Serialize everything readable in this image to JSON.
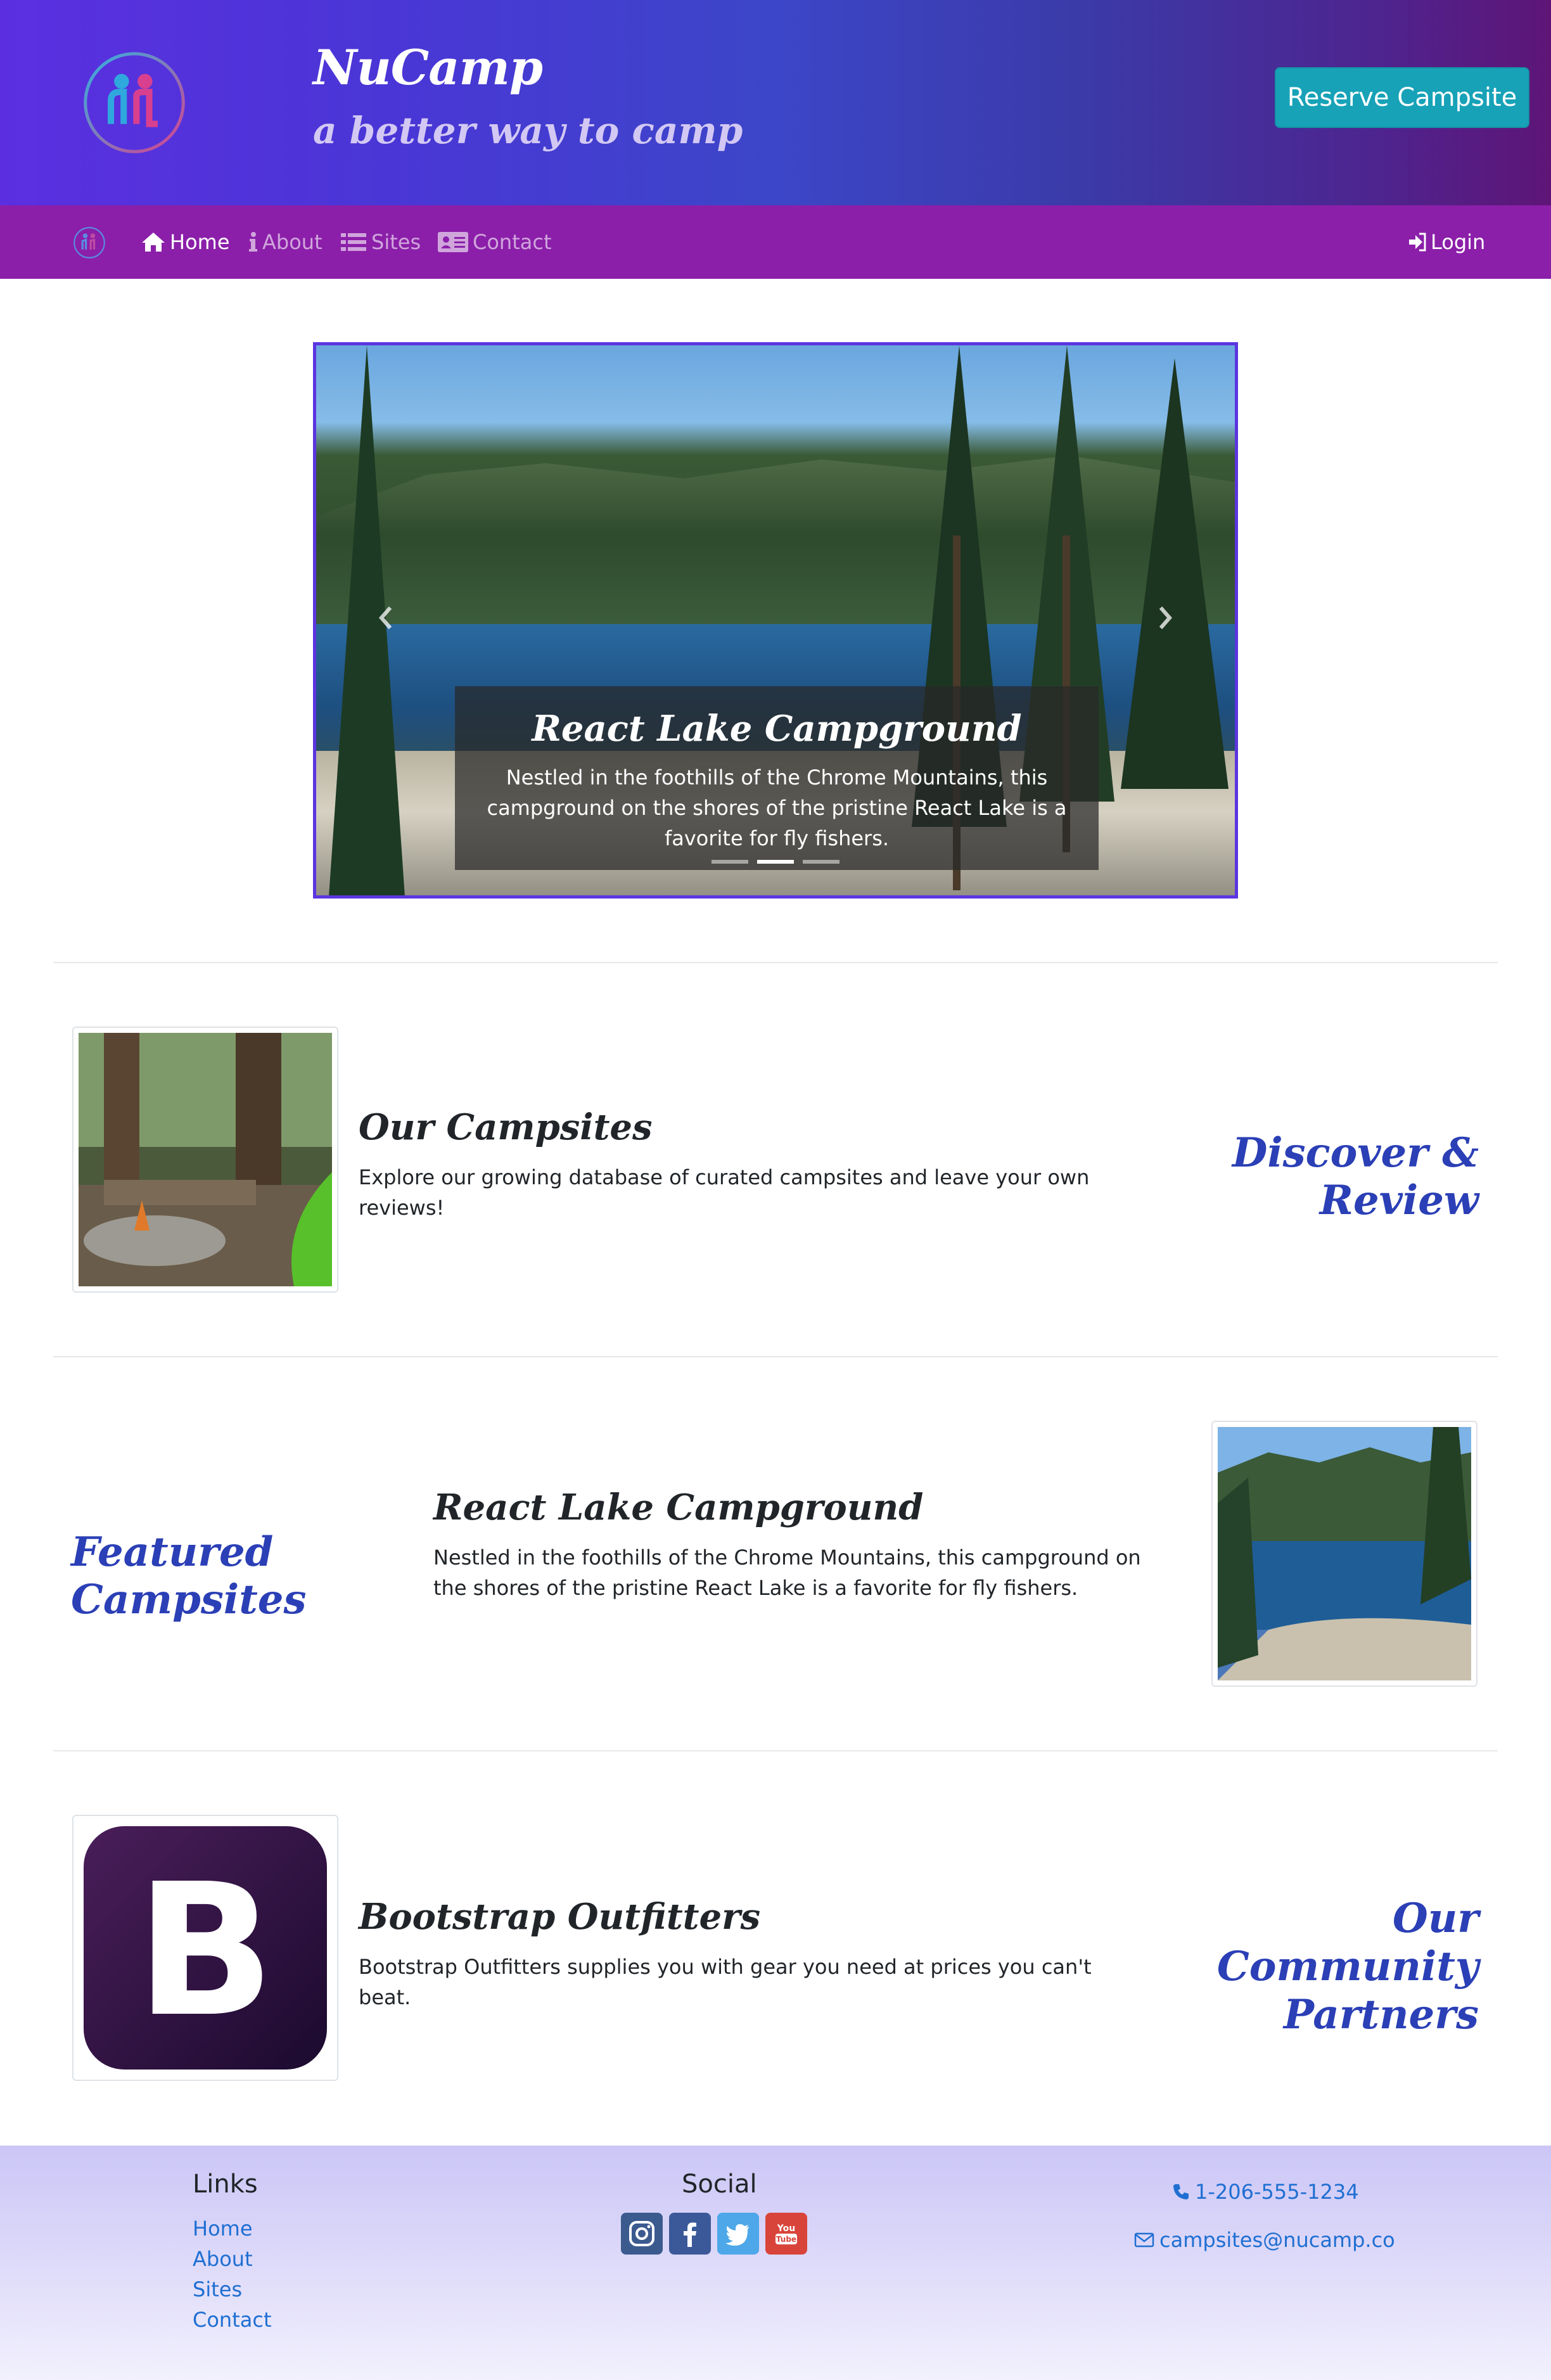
{
  "header": {
    "brand_title": "NuCamp",
    "tagline": "a better way to camp",
    "reserve_button": "Reserve Campsite"
  },
  "nav": {
    "items": [
      {
        "label": "Home",
        "icon": "home-icon",
        "active": true
      },
      {
        "label": "About",
        "icon": "info-icon",
        "active": false
      },
      {
        "label": "Sites",
        "icon": "list-icon",
        "active": false
      },
      {
        "label": "Contact",
        "icon": "address-card-icon",
        "active": false
      }
    ],
    "login": "Login"
  },
  "carousel": {
    "caption_title": "React Lake Campground",
    "caption_text": "Nestled in the foothills of the Chrome Mountains, this campground on the shores of the pristine React Lake is a favorite for fly fishers.",
    "slide_count": 3,
    "active_slide": 2
  },
  "sections": {
    "campsites": {
      "title": "Our Campsites",
      "text": "Explore our growing database of curated campsites and leave your own reviews!",
      "side_heading": "Discover & Review"
    },
    "featured": {
      "side_heading": "Featured Campsites",
      "title": "React Lake Campground",
      "text": "Nestled in the foothills of the Chrome Mountains, this campground on the shores of the pristine React Lake is a favorite for fly fishers."
    },
    "partners": {
      "title": "Bootstrap Outfitters",
      "text": "Bootstrap Outfitters supplies you with gear you need at prices you can't beat.",
      "side_heading_line1": "Our Community",
      "side_heading_line2": "Partners"
    }
  },
  "footer": {
    "links_heading": "Links",
    "links": [
      "Home",
      "About",
      "Sites",
      "Contact"
    ],
    "social_heading": "Social",
    "social": [
      "instagram-icon",
      "facebook-icon",
      "twitter-icon",
      "youtube-icon"
    ],
    "phone": "1-206-555-1234",
    "email": "campsites@nucamp.co"
  },
  "colors": {
    "accent": "#17a2b8",
    "navbar": "#8b1fa9",
    "heading_blue": "#2b3fb6",
    "link": "#1f6fd2"
  }
}
